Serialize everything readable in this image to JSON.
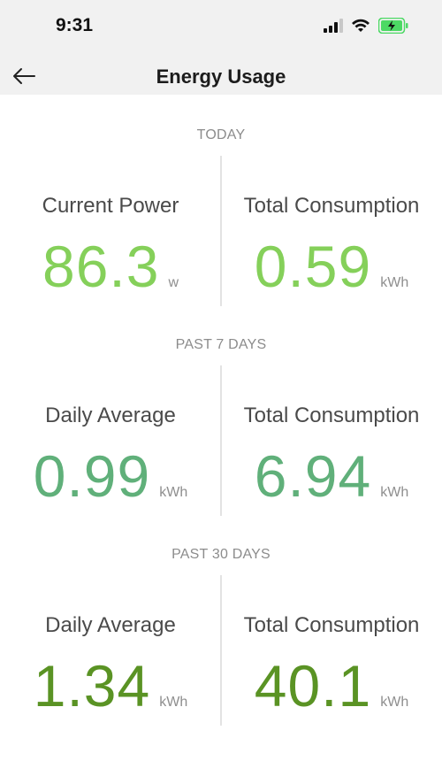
{
  "status_bar": {
    "time": "9:31"
  },
  "header": {
    "title": "Energy Usage"
  },
  "sections": [
    {
      "label": "TODAY",
      "left": {
        "label": "Current Power",
        "value": "86.3",
        "unit": "w"
      },
      "right": {
        "label": "Total Consumption",
        "value": "0.59",
        "unit": "kWh"
      }
    },
    {
      "label": "PAST 7 DAYS",
      "left": {
        "label": "Daily Average",
        "value": "0.99",
        "unit": "kWh"
      },
      "right": {
        "label": "Total Consumption",
        "value": "6.94",
        "unit": "kWh"
      }
    },
    {
      "label": "PAST 30 DAYS",
      "left": {
        "label": "Daily Average",
        "value": "1.34",
        "unit": "kWh"
      },
      "right": {
        "label": "Total Consumption",
        "value": "40.1",
        "unit": "kWh"
      }
    }
  ],
  "colors": {
    "today": "#85d05a",
    "past_7_days": "#60b07a",
    "past_30_days": "#5a9324",
    "header_bg": "#f1f1f1",
    "battery_charging": "#4cd964"
  },
  "icons": {
    "back": "arrow-left-icon",
    "signal": "cellular-signal-icon",
    "wifi": "wifi-icon",
    "battery": "battery-charging-icon"
  }
}
